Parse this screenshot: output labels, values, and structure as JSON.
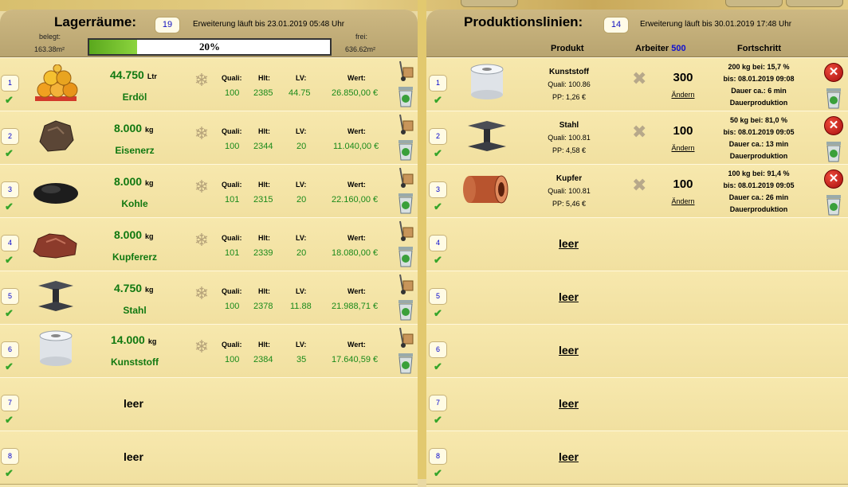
{
  "storage": {
    "title": "Lagerräume:",
    "count": "19",
    "expansion": "Erweiterung läuft bis 23.01.2019 05:48 Uhr",
    "used_label": "belegt:",
    "used_value": "163.38m²",
    "free_label": "frei:",
    "free_value": "636.62m²",
    "usage_text": "20%",
    "usage_fraction": 0.2,
    "bar_color": "#5aa81d",
    "rows": [
      {
        "num": "1",
        "qty": "44.750",
        "unit": "Ltr",
        "name": "Erdöl",
        "icon": "oil-barrels-icon",
        "quali": "100",
        "hlt": "2385",
        "lv": "44.75",
        "wert": "26.850,00 €"
      },
      {
        "num": "2",
        "qty": "8.000",
        "unit": "kg",
        "name": "Eisenerz",
        "icon": "iron-ore-icon",
        "quali": "100",
        "hlt": "2344",
        "lv": "20",
        "wert": "11.040,00 €"
      },
      {
        "num": "3",
        "qty": "8.000",
        "unit": "kg",
        "name": "Kohle",
        "icon": "coal-icon",
        "quali": "101",
        "hlt": "2315",
        "lv": "20",
        "wert": "22.160,00 €"
      },
      {
        "num": "4",
        "qty": "8.000",
        "unit": "kg",
        "name": "Kupfererz",
        "icon": "copper-ore-icon",
        "quali": "101",
        "hlt": "2339",
        "lv": "20",
        "wert": "18.080,00 €"
      },
      {
        "num": "5",
        "qty": "4.750",
        "unit": "kg",
        "name": "Stahl",
        "icon": "steel-beam-icon",
        "quali": "100",
        "hlt": "2378",
        "lv": "11.88",
        "wert": "21.988,71 €"
      },
      {
        "num": "6",
        "qty": "14.000",
        "unit": "kg",
        "name": "Kunststoff",
        "icon": "plastic-roll-icon",
        "quali": "100",
        "hlt": "2384",
        "lv": "35",
        "wert": "17.640,59 €"
      }
    ],
    "empty_rows": [
      {
        "num": "7",
        "label": "leer"
      },
      {
        "num": "8",
        "label": "leer"
      }
    ],
    "labels": {
      "quali": "Quali:",
      "hlt": "Hlt:",
      "lv": "LV:",
      "wert": "Wert:"
    }
  },
  "production": {
    "title": "Produktionslinien:",
    "count": "14",
    "expansion": "Erweiterung läuft bis 30.01.2019 17:48 Uhr",
    "col_product": "Produkt",
    "col_workers": "Arbeiter",
    "workers_total": "500",
    "col_progress": "Fortschritt",
    "change_label": "Ändern",
    "lines": [
      {
        "num": "1",
        "product": "Kunststoff",
        "icon": "plastic-roll-icon",
        "quali": "Quali: 100.86",
        "pp": "PP: 1,26 €",
        "workers": "300",
        "p1": "200 kg bei: 15,7 %",
        "p2": "bis: 08.01.2019 09:08",
        "p3": "Dauer ca.: 6 min",
        "p4": "Dauerproduktion"
      },
      {
        "num": "2",
        "product": "Stahl",
        "icon": "steel-beam-icon",
        "quali": "Quali: 100.81",
        "pp": "PP: 4,58 €",
        "workers": "100",
        "p1": "50 kg bei: 81,0 %",
        "p2": "bis: 08.01.2019 09:05",
        "p3": "Dauer ca.: 13 min",
        "p4": "Dauerproduktion"
      },
      {
        "num": "3",
        "product": "Kupfer",
        "icon": "copper-coil-icon",
        "quali": "Quali: 100.81",
        "pp": "PP: 5,46 €",
        "workers": "100",
        "p1": "100 kg bei: 91,4 %",
        "p2": "bis: 08.01.2019 09:05",
        "p3": "Dauer ca.: 26 min",
        "p4": "Dauerproduktion"
      }
    ],
    "empty_lines": [
      {
        "num": "4",
        "label": "leer"
      },
      {
        "num": "5",
        "label": "leer"
      },
      {
        "num": "6",
        "label": "leer"
      },
      {
        "num": "7",
        "label": "leer"
      },
      {
        "num": "8",
        "label": "leer"
      }
    ]
  }
}
